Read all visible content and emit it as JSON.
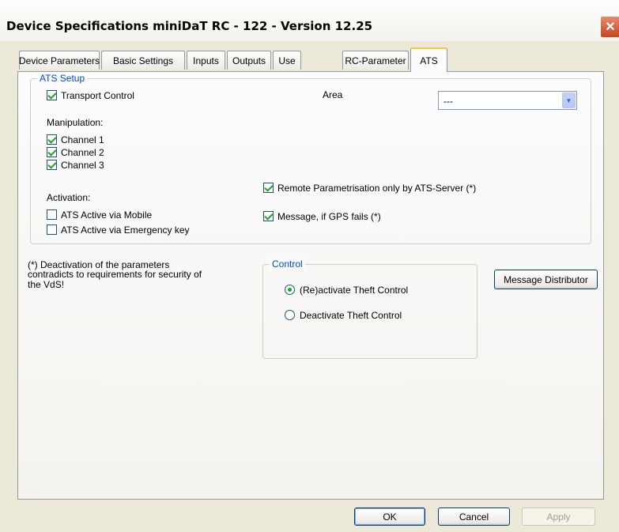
{
  "window": {
    "title": "Device Specifications miniDaT RC - 122 - Version 12.25",
    "close_glyph": "✕"
  },
  "tabs": [
    {
      "label": "Device Parameters",
      "active": false
    },
    {
      "label": "Basic Settings",
      "active": false
    },
    {
      "label": "Inputs",
      "active": false
    },
    {
      "label": "Outputs",
      "active": false
    },
    {
      "label": "Use",
      "active": false
    },
    {
      "label": "RC-Parameter",
      "active": false
    },
    {
      "label": "ATS",
      "active": true
    }
  ],
  "ats_setup": {
    "legend": "ATS Setup",
    "transport_control": {
      "label": "Transport Control",
      "checked": true
    },
    "area": {
      "label": "Area",
      "value": "---"
    },
    "manipulation": {
      "label": "Manipulation:",
      "channels": [
        {
          "label": "Channel 1",
          "checked": true
        },
        {
          "label": "Channel 2",
          "checked": true
        },
        {
          "label": "Channel 3",
          "checked": true
        }
      ]
    },
    "activation": {
      "label": "Activation:",
      "mobile": {
        "label": "ATS Active via Mobile",
        "checked": false
      },
      "emergency": {
        "label": "ATS Active via Emergency key",
        "checked": false
      }
    },
    "remote_param": {
      "label": "Remote Parametrisation only by ATS-Server (*)",
      "checked": true
    },
    "gps_message": {
      "label": "Message, if GPS fails (*)",
      "checked": true
    }
  },
  "note": {
    "line1": "(*) Deactivation of the parameters",
    "line2": "contradicts to requirements for security of",
    "line3": "the VdS!"
  },
  "control": {
    "legend": "Control",
    "reactivate": {
      "label": "(Re)activate Theft Control",
      "selected": true
    },
    "deactivate": {
      "label": "Deactivate Theft Control",
      "selected": false
    }
  },
  "buttons": {
    "message_distributor": "Message Distributor",
    "ok": "OK",
    "cancel": "Cancel",
    "apply": "Apply"
  },
  "colors": {
    "accent": "#0046d5",
    "check": "#21a121",
    "tab_highlight": "#ffc83c"
  }
}
